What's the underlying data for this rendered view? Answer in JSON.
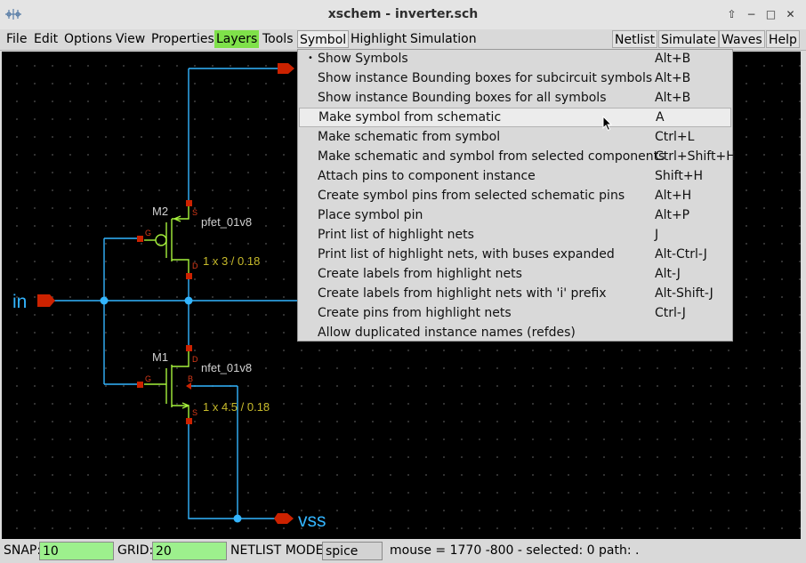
{
  "window": {
    "title": "xschem - inverter.sch",
    "controls": {
      "up": "⇧",
      "minimize": "−",
      "maximize": "□",
      "close": "✕"
    }
  },
  "menubar": {
    "left": [
      "File",
      "Edit",
      "Options",
      "View",
      "Properties",
      "Layers",
      "Tools",
      "Symbol",
      "Highlight",
      "Simulation"
    ],
    "right": [
      "Netlist",
      "Simulate",
      "Waves",
      "Help"
    ],
    "active": "Symbol",
    "highlight_color": "#7fe14a"
  },
  "symbol_menu": {
    "items": [
      {
        "label": "Show Symbols",
        "accel": "Alt+B",
        "bullet": "•"
      },
      {
        "label": "Show instance Bounding boxes for subcircuit symbols",
        "accel": "Alt+B"
      },
      {
        "label": "Show instance Bounding boxes for all symbols",
        "accel": "Alt+B"
      },
      {
        "label": "Make symbol from schematic",
        "accel": "A",
        "hovered": true
      },
      {
        "label": "Make schematic from symbol",
        "accel": "Ctrl+L"
      },
      {
        "label": "Make schematic and symbol from selected components",
        "accel": "Ctrl+Shift+H"
      },
      {
        "label": "Attach pins to component instance",
        "accel": "Shift+H"
      },
      {
        "label": "Create symbol pins from selected schematic pins",
        "accel": "Alt+H"
      },
      {
        "label": "Place symbol pin",
        "accel": "Alt+P"
      },
      {
        "label": "Print list of highlight nets",
        "accel": "J"
      },
      {
        "label": "Print list of highlight nets, with buses expanded",
        "accel": "Alt-Ctrl-J"
      },
      {
        "label": "Create labels from highlight nets",
        "accel": "Alt-J"
      },
      {
        "label": "Create labels from highlight nets with 'i' prefix",
        "accel": "Alt-Shift-J"
      },
      {
        "label": "Create pins from highlight nets",
        "accel": "Ctrl-J"
      },
      {
        "label": "Allow duplicated instance names (refdes)",
        "accel": ""
      }
    ]
  },
  "schematic": {
    "pin_in": "in",
    "pin_vss": "vss",
    "m2": {
      "name": "M2",
      "model": "pfet_01v8",
      "size": "1 x 3 / 0.18",
      "pins": {
        "g": "G",
        "s": "S",
        "d": "D"
      }
    },
    "m1": {
      "name": "M1",
      "model": "nfet_01v8",
      "size": "1 x 4.5 / 0.18",
      "pins": {
        "g": "G",
        "s": "S",
        "d": "D",
        "b": "B"
      }
    },
    "colors": {
      "wire": "#33b5ff",
      "pin": "#cc2200",
      "device": "#a6f23c",
      "label": "#d0d0d0",
      "param": "#c8bb2b",
      "pinlabel": "#d83a1a"
    }
  },
  "statusbar": {
    "snap_label": "SNAP:",
    "snap_value": "10",
    "grid_label": "GRID:",
    "grid_value": "20",
    "netlist_label": "NETLIST MODE:",
    "netlist_value": "spice",
    "info": "mouse = 1770 -800 - selected: 0 path: ."
  }
}
